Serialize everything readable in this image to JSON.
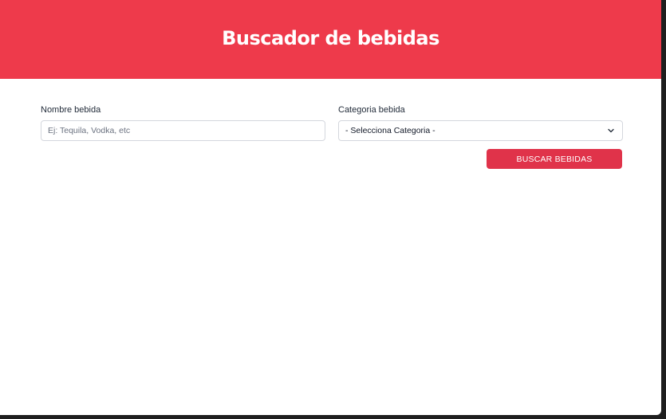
{
  "header": {
    "title": "Buscador de bebidas"
  },
  "form": {
    "nombre": {
      "label": "Nombre bebida",
      "placeholder": "Ej: Tequila, Vodka, etc",
      "value": ""
    },
    "categoria": {
      "label": "Categoria bebida",
      "selected": "- Selecciona Categoria -",
      "icon": "chevron-down-icon"
    },
    "submit_label": "BUSCAR BEBIDAS"
  },
  "colors": {
    "header_bg": "#ee3a4b",
    "button_bg": "#e0334a",
    "border": "#d4d7dd"
  }
}
